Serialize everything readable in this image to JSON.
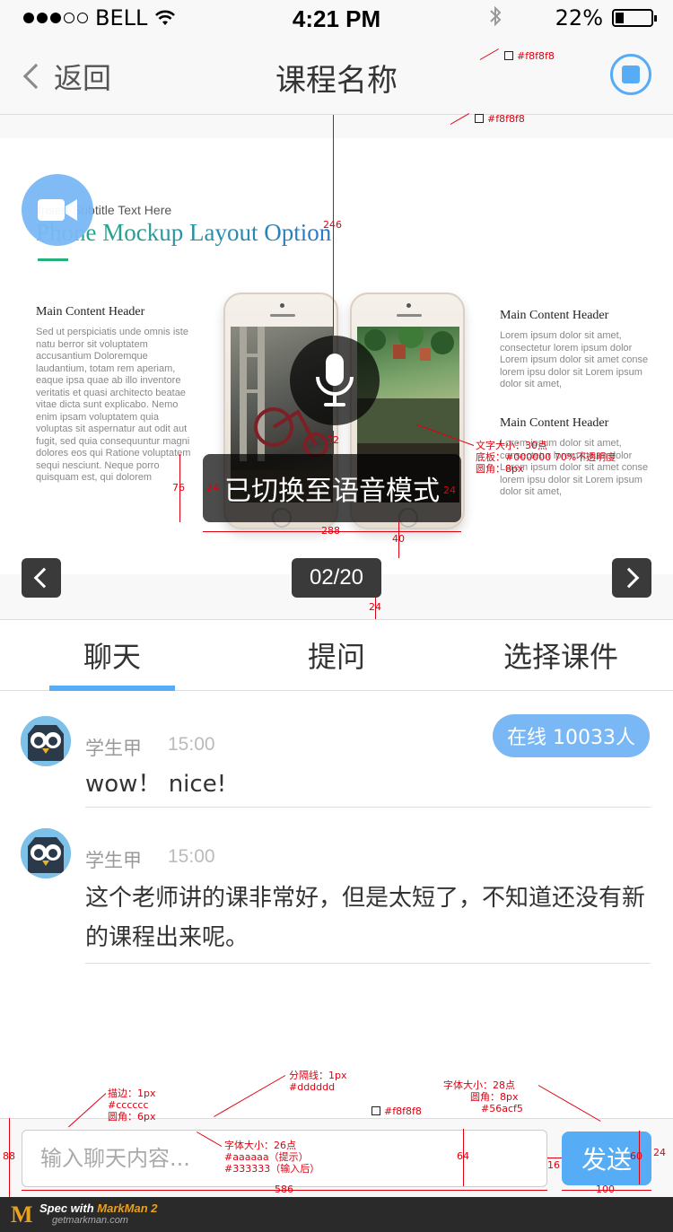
{
  "status_bar": {
    "carrier": "BELL",
    "time": "4:21 PM",
    "battery": "22%",
    "battery_level": 0.22,
    "signal_bars": 3,
    "signal_total": 5
  },
  "nav": {
    "back_label": "返回",
    "title": "课程名称",
    "record_icon": "stop-icon"
  },
  "slide": {
    "subtitle": "Insert Subtitle Text Here",
    "title": "Phone Mockup Layout Option",
    "left_header": "Main Content Header",
    "left_text": "Sed ut perspiciatis unde omnis iste natu berror sit voluptatem accusantium Doloremque laudantium, totam rem aperiam, eaque ipsa quae ab illo inventore veritatis et quasi architecto beatae vitae dicta sunt explicabo. Nemo enim ipsam voluptatem quia voluptas sit aspernatur aut odit aut fugit, sed quia consequuntur magni dolores eos qui Ratione voluptatem sequi nesciunt. Neque porro quisquam est, qui dolorem",
    "right_header_1": "Main Content Header",
    "right_text_1": "Lorem ipsum dolor sit amet, consectetur lorem ipsum dolor Lorem ipsum dolor sit amet conse lorem ipsu dolor sit Lorem ipsum dolor sit amet,",
    "right_header_2": "Main Content Header",
    "right_text_2": "Lorem ipsum dolor sit amet, consectetur lorem ipsum dolor Lorem ipsum dolor sit amet conse lorem ipsu dolor sit Lorem ipsum dolor sit amet,",
    "voice_toast": "已切换至语音模式",
    "page_counter": "02/20"
  },
  "tabs": [
    {
      "label": "聊天",
      "active": true
    },
    {
      "label": "提问",
      "active": false
    },
    {
      "label": "选择课件",
      "active": false
    }
  ],
  "chat": {
    "online_badge": "在线 10033人",
    "messages": [
      {
        "name": "学生甲",
        "time": "15:00",
        "text": "wow！ nice!"
      },
      {
        "name": "学生甲",
        "time": "15:00",
        "text": "这个老师讲的课非常好，但是太短了，不知道还没有新的课程出来呢。"
      }
    ]
  },
  "input": {
    "placeholder": "输入聊天内容...",
    "value": "",
    "send_label": "发送"
  },
  "footer": {
    "brand_prefix": "Spec with ",
    "brand_name": "MarkMan 2",
    "url": "getmarkman.com"
  },
  "annotations": {
    "nav_bg": "#f8f8f8",
    "stage_bg": "#f8f8f8",
    "input_bg": "#f8f8f8",
    "dim_246": "246",
    "dim_32": "32",
    "dim_76": "76",
    "dim_24a": "24",
    "dim_24b": "24",
    "dim_288": "288",
    "dim_40": "40",
    "dim_24c": "24",
    "toast_spec_1": "文字大小：30点",
    "toast_spec_2": "底板：#000000 70%不透明度",
    "toast_spec_3": "圆角：8px",
    "border_spec_1": "描边：1px",
    "border_spec_2": "#cccccc",
    "border_spec_3": "圆角：6px",
    "divider_spec_1": "分隔线：1px",
    "divider_spec_2": "#dddddd",
    "btn_spec_1": "字体大小：28点",
    "btn_spec_2": "圆角：8px",
    "btn_spec_3": "#56acf5",
    "input_spec_1": "字体大小：26点",
    "input_spec_2": "#aaaaaa（提示）",
    "input_spec_3": "#333333（输入后）",
    "dim_88": "88",
    "dim_64": "64",
    "dim_16": "16",
    "dim_60": "60",
    "dim_24d": "24",
    "dim_586": "586",
    "dim_100": "100"
  },
  "colors": {
    "accent": "#56acf5",
    "toast_bg": "#000000",
    "border": "#cccccc",
    "divider": "#dddddd",
    "placeholder": "#aaaaaa",
    "input_text": "#333333",
    "annotation": "#e0000f"
  }
}
